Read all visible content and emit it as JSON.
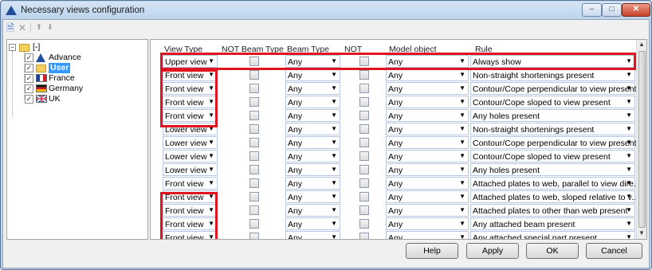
{
  "window": {
    "title": "Necessary views configuration",
    "controls": {
      "minimize": "–",
      "maximize": "□",
      "close": "✕"
    }
  },
  "toolbar": {
    "icons": [
      "new-document-icon",
      "delete-icon",
      "move-up-icon",
      "move-down-icon"
    ],
    "glyphs": {
      "new": "🗎",
      "delete": "✕",
      "up": "⬆",
      "down": "⬇"
    }
  },
  "tree": {
    "root_label": "[-]",
    "items": [
      {
        "label": "Advance",
        "checked": true,
        "icon": "advance-logo-icon"
      },
      {
        "label": "User",
        "checked": true,
        "icon": "folder-icon",
        "selected": true
      },
      {
        "label": "France",
        "checked": true,
        "icon": "flag-france-icon"
      },
      {
        "label": "Germany",
        "checked": true,
        "icon": "flag-germany-icon"
      },
      {
        "label": "UK",
        "checked": true,
        "icon": "flag-uk-icon"
      }
    ]
  },
  "grid": {
    "columns": [
      "View Type",
      "NOT Beam Type",
      "Beam Type",
      "NOT",
      "Model object",
      "Rule"
    ],
    "rows": [
      {
        "view_type": "Upper view",
        "beam_type": "Any",
        "model_object": "Any",
        "rule": "Always show"
      },
      {
        "view_type": "Front view",
        "beam_type": "Any",
        "model_object": "Any",
        "rule": "Non-straight shortenings present"
      },
      {
        "view_type": "Front view",
        "beam_type": "Any",
        "model_object": "Any",
        "rule": "Contour/Cope perpendicular to view present"
      },
      {
        "view_type": "Front view",
        "beam_type": "Any",
        "model_object": "Any",
        "rule": "Contour/Cope sloped to view present"
      },
      {
        "view_type": "Front view",
        "beam_type": "Any",
        "model_object": "Any",
        "rule": "Any holes present"
      },
      {
        "view_type": "Lower view",
        "beam_type": "Any",
        "model_object": "Any",
        "rule": "Non-straight shortenings present"
      },
      {
        "view_type": "Lower view",
        "beam_type": "Any",
        "model_object": "Any",
        "rule": "Contour/Cope perpendicular to view present"
      },
      {
        "view_type": "Lower view",
        "beam_type": "Any",
        "model_object": "Any",
        "rule": "Contour/Cope sloped to view present"
      },
      {
        "view_type": "Lower view",
        "beam_type": "Any",
        "model_object": "Any",
        "rule": "Any holes present"
      },
      {
        "view_type": "Front view",
        "beam_type": "Any",
        "model_object": "Any",
        "rule": "Attached plates to web, parallel to view dire..."
      },
      {
        "view_type": "Front view",
        "beam_type": "Any",
        "model_object": "Any",
        "rule": "Attached plates to web, sloped relative to v..."
      },
      {
        "view_type": "Front view",
        "beam_type": "Any",
        "model_object": "Any",
        "rule": "Attached plates to other than web present"
      },
      {
        "view_type": "Front view",
        "beam_type": "Any",
        "model_object": "Any",
        "rule": "Any attached beam present"
      },
      {
        "view_type": "Front view",
        "beam_type": "Any",
        "model_object": "Any",
        "rule": "Any attached special part present"
      }
    ]
  },
  "buttons": {
    "help": "Help",
    "apply": "Apply",
    "ok": "OK",
    "cancel": "Cancel"
  },
  "colors": {
    "highlight_box": "#e0141e",
    "selection": "#3399ff",
    "title_bar": "#bcd3ec"
  }
}
